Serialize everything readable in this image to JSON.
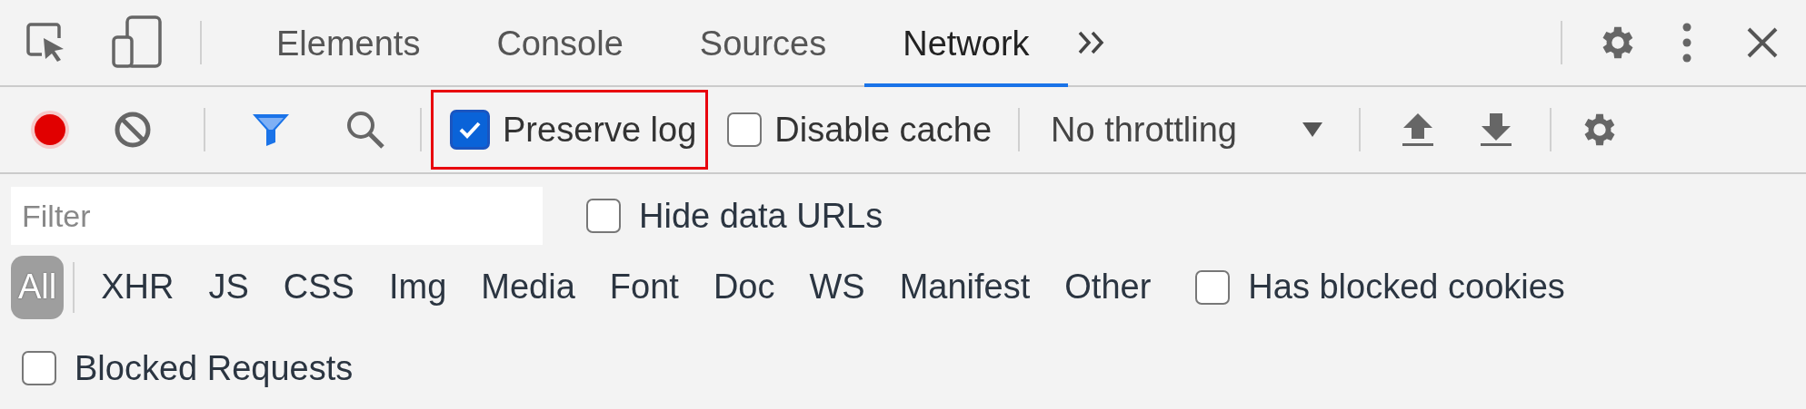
{
  "tabs": [
    {
      "label": "Elements",
      "selected": false
    },
    {
      "label": "Console",
      "selected": false
    },
    {
      "label": "Sources",
      "selected": false
    },
    {
      "label": "Network",
      "selected": true
    }
  ],
  "toolbar": {
    "recording": true,
    "preserve_log": {
      "label": "Preserve log",
      "checked": true,
      "highlighted": true
    },
    "disable_cache": {
      "label": "Disable cache",
      "checked": false
    },
    "throttling": "No throttling"
  },
  "filter": {
    "placeholder": "Filter"
  },
  "hide_data_urls": {
    "label": "Hide data URLs",
    "checked": false
  },
  "types": [
    {
      "label": "All",
      "selected": true
    },
    {
      "label": "XHR",
      "selected": false
    },
    {
      "label": "JS",
      "selected": false
    },
    {
      "label": "CSS",
      "selected": false
    },
    {
      "label": "Img",
      "selected": false
    },
    {
      "label": "Media",
      "selected": false
    },
    {
      "label": "Font",
      "selected": false
    },
    {
      "label": "Doc",
      "selected": false
    },
    {
      "label": "WS",
      "selected": false
    },
    {
      "label": "Manifest",
      "selected": false
    },
    {
      "label": "Other",
      "selected": false
    }
  ],
  "has_blocked_cookies": {
    "label": "Has blocked cookies",
    "checked": false
  },
  "blocked_requests": {
    "label": "Blocked Requests",
    "checked": false
  }
}
